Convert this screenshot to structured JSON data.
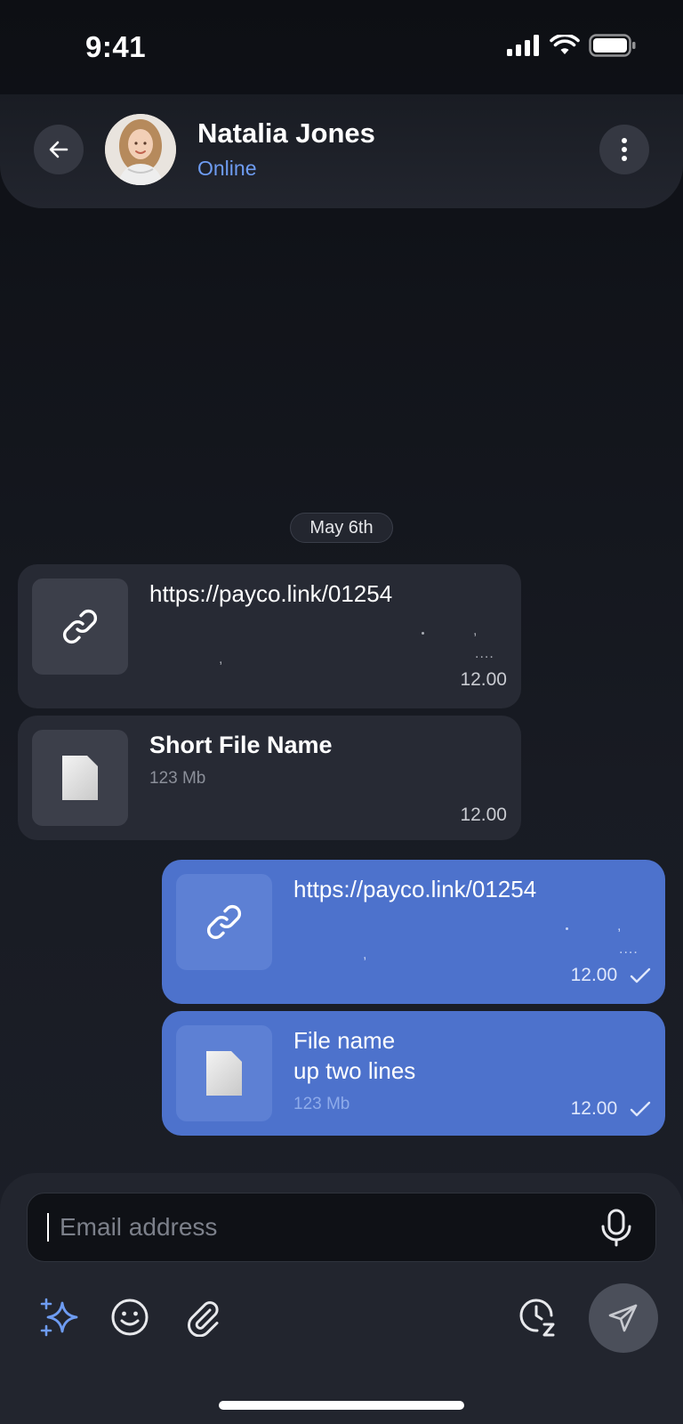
{
  "status_bar": {
    "time": "9:41"
  },
  "header": {
    "contact_name": "Natalia Jones",
    "contact_status": "Online",
    "status_color": "#6e9cf2"
  },
  "conversation": {
    "date_divider": "May 6th",
    "messages": [
      {
        "direction": "incoming",
        "type": "link",
        "title": "https://payco.link/01254",
        "time": "12.00"
      },
      {
        "direction": "incoming",
        "type": "file",
        "title": "Short File Name",
        "size": "123 Mb",
        "time": "12.00"
      },
      {
        "direction": "outgoing",
        "type": "link",
        "title": "https://payco.link/01254",
        "time": "12.00",
        "read": true
      },
      {
        "direction": "outgoing",
        "type": "file",
        "title_line1": "File name",
        "title_line2": "up two lines",
        "size": "123 Mb",
        "time": "12.00",
        "read": true
      }
    ]
  },
  "composer": {
    "placeholder": "Email address",
    "value": ""
  },
  "icons": {
    "back": "arrow-left-icon",
    "more": "more-vertical-icon",
    "link": "link-icon",
    "file": "file-icon",
    "read": "check-icon",
    "mic": "microphone-icon",
    "ai": "sparkles-icon",
    "emoji": "emoji-icon",
    "attach": "paperclip-icon",
    "schedule": "clock-snooze-icon",
    "send": "send-icon"
  },
  "colors": {
    "outgoing_bubble": "#4d72cc",
    "incoming_bubble": "#272a34",
    "accent": "#6e9cf2"
  }
}
